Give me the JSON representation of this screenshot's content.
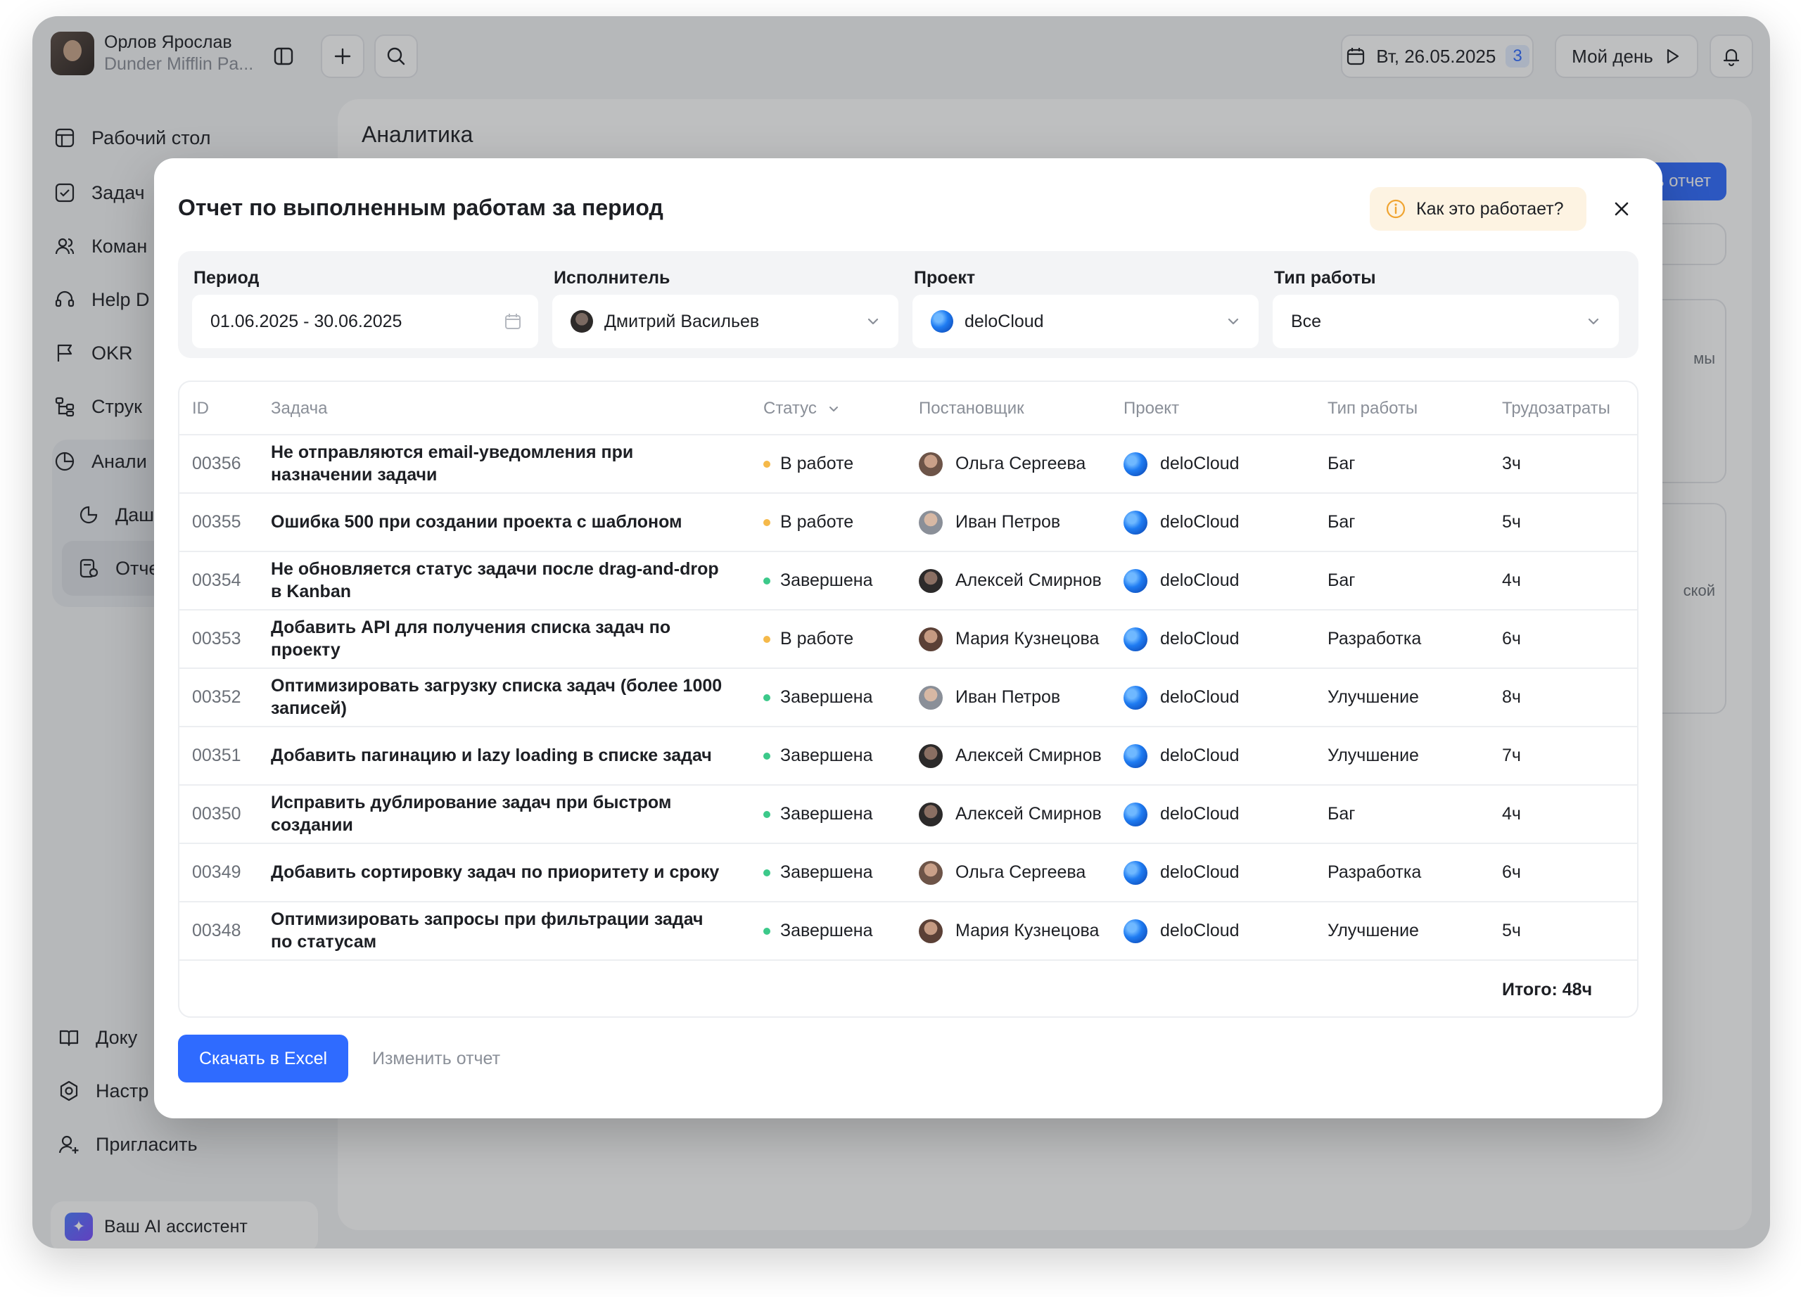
{
  "user": {
    "name": "Орлов Ярослав",
    "org": "Dunder Mifflin Pa..."
  },
  "topbar": {
    "date_label": "Вт, 26.05.2025",
    "date_badge": "3",
    "my_day_label": "Мой день",
    "icons": [
      "sidebar-toggle-icon",
      "plus-icon",
      "search-icon",
      "calendar-icon",
      "play-icon",
      "bell-icon"
    ]
  },
  "sidebar": {
    "items": [
      {
        "label": "Рабочий стол",
        "icon": "desktop-icon"
      },
      {
        "label": "Задач",
        "icon": "task-check-icon"
      },
      {
        "label": "Коман",
        "icon": "team-icon"
      },
      {
        "label": "Help D",
        "icon": "headset-icon"
      },
      {
        "label": "OKR",
        "icon": "flag-icon"
      },
      {
        "label": "Струк",
        "icon": "structure-icon"
      },
      {
        "label": "Анали",
        "icon": "pie-chart-icon"
      },
      {
        "label": "Даш",
        "icon": "dashboard-icon"
      },
      {
        "label": "Отче",
        "icon": "report-icon"
      }
    ],
    "bottom_items": [
      {
        "label": "Доку",
        "icon": "book-icon"
      },
      {
        "label": "Настр",
        "icon": "settings-icon"
      },
      {
        "label": "Пригласить",
        "icon": "invite-user-icon"
      }
    ],
    "ai_assistant": "Ваш AI ассистент"
  },
  "main": {
    "title": "Аналитика",
    "report_button": "ь отчет",
    "card_text_1": "мы",
    "card_text_2": "ской"
  },
  "modal": {
    "title": "Отчет по выполненным работам за период",
    "how_it_works": "Как это работает?",
    "filters": {
      "period_label": "Период",
      "period_value": "01.06.2025 - 30.06.2025",
      "assignee_label": "Исполнитель",
      "assignee_value": "Дмитрий Васильев",
      "project_label": "Проект",
      "project_value": "deloCloud",
      "work_type_label": "Тип работы",
      "work_type_value": "Все"
    },
    "table": {
      "headers": {
        "id": "ID",
        "task": "Задача",
        "status": "Статус",
        "author": "Постановщик",
        "project": "Проект",
        "work_type": "Тип работы",
        "effort": "Трудозатраты"
      },
      "rows": [
        {
          "id": "00356",
          "task": "Не отправляются email-уведомления при назначении задачи",
          "status": "В работе",
          "author": "Ольга Сергеева",
          "project": "deloCloud",
          "work_type": "Баг",
          "effort": "3ч"
        },
        {
          "id": "00355",
          "task": "Ошибка 500 при создании проекта с шаблоном",
          "status": "В работе",
          "author": "Иван Петров",
          "project": "deloCloud",
          "work_type": "Баг",
          "effort": "5ч"
        },
        {
          "id": "00354",
          "task": "Не обновляется статус задачи после drag-and-drop в Kanban",
          "status": "Завершена",
          "author": "Алексей Смирнов",
          "project": "deloCloud",
          "work_type": "Баг",
          "effort": "4ч"
        },
        {
          "id": "00353",
          "task": "Добавить API для получения списка задач по проекту",
          "status": "В работе",
          "author": "Мария Кузнецова",
          "project": "deloCloud",
          "work_type": "Разработка",
          "effort": "6ч"
        },
        {
          "id": "00352",
          "task": "Оптимизировать загрузку списка задач (более 1000 записей)",
          "status": "Завершена",
          "author": "Иван Петров",
          "project": "deloCloud",
          "work_type": "Улучшение",
          "effort": "8ч"
        },
        {
          "id": "00351",
          "task": "Добавить пагинацию и lazy loading в списке задач",
          "status": "Завершена",
          "author": "Алексей Смирнов",
          "project": "deloCloud",
          "work_type": "Улучшение",
          "effort": "7ч"
        },
        {
          "id": "00350",
          "task": "Исправить дублирование задач при быстром создании",
          "status": "Завершена",
          "author": "Алексей Смирнов",
          "project": "deloCloud",
          "work_type": "Баг",
          "effort": "4ч"
        },
        {
          "id": "00349",
          "task": "Добавить сортировку задач по приоритету и сроку",
          "status": "Завершена",
          "author": "Ольга Сергеева",
          "project": "deloCloud",
          "work_type": "Разработка",
          "effort": "6ч"
        },
        {
          "id": "00348",
          "task": "Оптимизировать запросы при фильтрации задач по статусам",
          "status": "Завершена",
          "author": "Мария Кузнецова",
          "project": "deloCloud",
          "work_type": "Улучшение",
          "effort": "5ч"
        }
      ],
      "total": "Итого: 48ч"
    },
    "download_button": "Скачать в Excel",
    "edit_button": "Изменить отчет"
  },
  "colors": {
    "accent": "#2f6bff",
    "status_in_progress": "#f5b94a",
    "status_done": "#3cc98a",
    "hint_bg": "#fdf3e2",
    "hint_icon": "#f0a431"
  }
}
